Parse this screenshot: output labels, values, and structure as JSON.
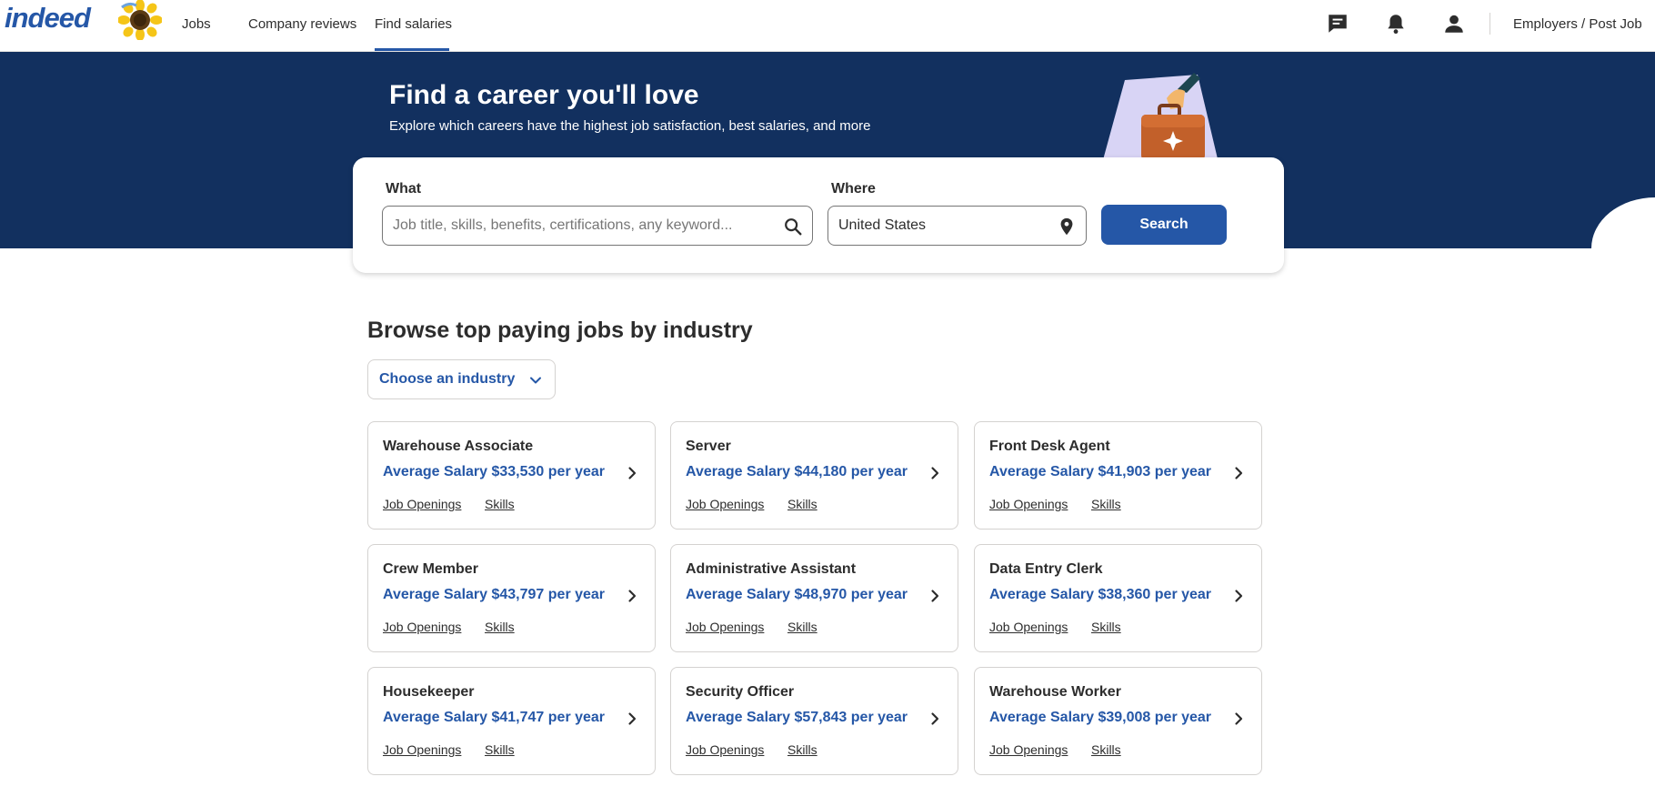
{
  "header": {
    "logo": "indeed",
    "nav": [
      "Jobs",
      "Company reviews",
      "Find salaries"
    ],
    "active_nav": "Find salaries",
    "employers_link": "Employers / Post Job"
  },
  "hero": {
    "title": "Find a career you'll love",
    "subtitle": "Explore which careers have the highest job satisfaction, best salaries, and more"
  },
  "search": {
    "what_label": "What",
    "what_placeholder": "Job title, skills, benefits, certifications, any keyword...",
    "where_label": "Where",
    "where_value": "United States",
    "button_label": "Search"
  },
  "browse": {
    "title": "Browse top paying jobs by industry",
    "industry_button": "Choose an industry"
  },
  "cards": [
    {
      "title": "Warehouse Associate",
      "salary": "Average Salary $33,530 per year",
      "link1": "Job Openings",
      "link2": "Skills"
    },
    {
      "title": "Server",
      "salary": "Average Salary $44,180 per year",
      "link1": "Job Openings",
      "link2": "Skills"
    },
    {
      "title": "Front Desk Agent",
      "salary": "Average Salary $41,903 per year",
      "link1": "Job Openings",
      "link2": "Skills"
    },
    {
      "title": "Crew Member",
      "salary": "Average Salary $43,797 per year",
      "link1": "Job Openings",
      "link2": "Skills"
    },
    {
      "title": "Administrative Assistant",
      "salary": "Average Salary $48,970 per year",
      "link1": "Job Openings",
      "link2": "Skills"
    },
    {
      "title": "Data Entry Clerk",
      "salary": "Average Salary $38,360 per year",
      "link1": "Job Openings",
      "link2": "Skills"
    },
    {
      "title": "Housekeeper",
      "salary": "Average Salary $41,747 per year",
      "link1": "Job Openings",
      "link2": "Skills"
    },
    {
      "title": "Security Officer",
      "salary": "Average Salary $57,843 per year",
      "link1": "Job Openings",
      "link2": "Skills"
    },
    {
      "title": "Warehouse Worker",
      "salary": "Average Salary $39,008 per year",
      "link1": "Job Openings",
      "link2": "Skills"
    }
  ],
  "colors": {
    "brand_blue": "#2557a7",
    "hero_navy": "#12305f"
  },
  "icons": [
    "messages-icon",
    "notifications-icon",
    "account-icon",
    "search-icon",
    "location-pin-icon",
    "chevron-down-icon",
    "chevron-right-icon"
  ]
}
